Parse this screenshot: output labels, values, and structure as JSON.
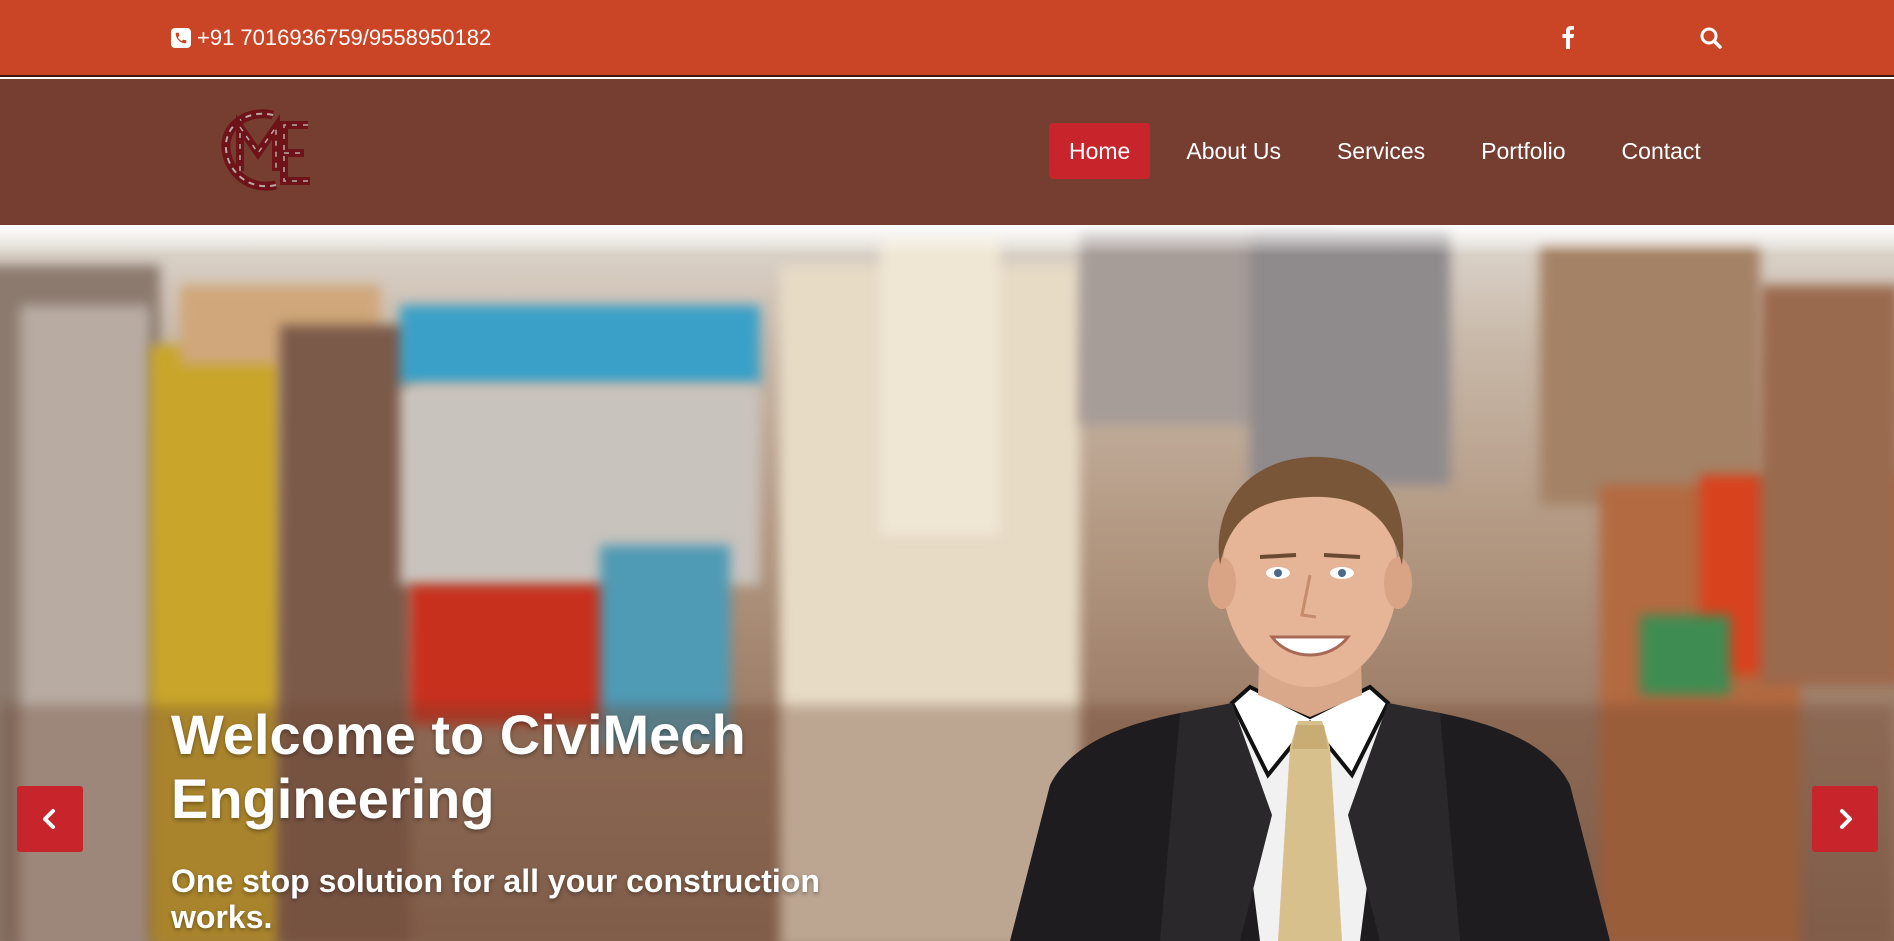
{
  "topbar": {
    "phone_icon": "phone-icon",
    "phone_text": "+91 7016936759/9558950182",
    "social_icon": "facebook-icon",
    "search_icon": "search-icon",
    "background_color": "#c94526"
  },
  "navbar": {
    "background_color": "#763e31",
    "logo_text": "CME",
    "items": [
      {
        "label": "Home",
        "active": true
      },
      {
        "label": "About Us",
        "active": false
      },
      {
        "label": "Services",
        "active": false
      },
      {
        "label": "Portfolio",
        "active": false
      },
      {
        "label": "Contact",
        "active": false
      }
    ],
    "active_color": "#c8242c"
  },
  "hero": {
    "title": "Welcome to CiviMech Engineering",
    "subtitle": "One stop solution for all your construction works.",
    "prev_icon": "chevron-left-icon",
    "next_icon": "chevron-right-icon",
    "arrow_color": "#c8242c"
  }
}
